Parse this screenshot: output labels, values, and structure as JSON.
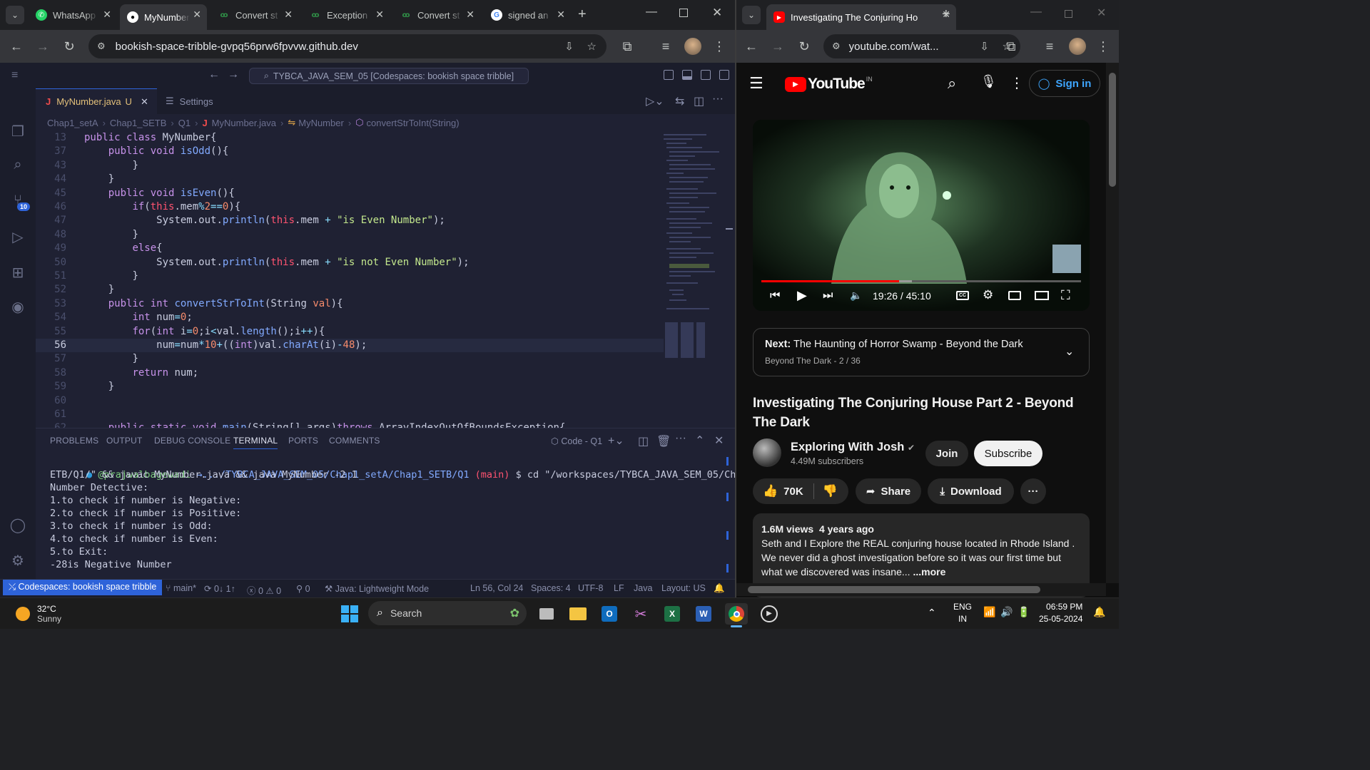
{
  "left_browser": {
    "tabs": [
      {
        "title": "WhatsApp",
        "icon": "whatsapp-icon"
      },
      {
        "title": "MyNumber",
        "icon": "github-icon",
        "active": true
      },
      {
        "title": "Convert st",
        "icon": "geeksforgeeks-icon"
      },
      {
        "title": "Exception",
        "icon": "geeksforgeeks-icon"
      },
      {
        "title": "Convert st",
        "icon": "geeksforgeeks-icon"
      },
      {
        "title": "signed an",
        "icon": "google-icon"
      }
    ],
    "url": "bookish-space-tribble-gvpq56prw6fpvvw.github.dev"
  },
  "vscode": {
    "command_center": "TYBCA_JAVA_SEM_05 [Codespaces: bookish space tribble]",
    "tabs": [
      {
        "label": "MyNumber.java",
        "badge": "U",
        "active": true
      },
      {
        "label": "Settings",
        "active": false
      }
    ],
    "breadcrumb": [
      "Chap1_setA",
      "Chap1_SETB",
      "Q1",
      "MyNumber.java",
      "MyNumber",
      "convertStrToInt(String)"
    ],
    "scm_badge": "10",
    "code_lines": [
      {
        "n": "13",
        "html": "<span class='kw'>public</span> <span class='kw'>class</span> <span class='pl'>MyNumber{</span>"
      },
      {
        "n": "37",
        "html": "    <span class='kw'>public</span> <span class='kw'>void</span> <span class='fn'>isOdd</span><span class='pl'>(){</span>"
      },
      {
        "n": "43",
        "html": "        <span class='pl'>}</span>"
      },
      {
        "n": "44",
        "html": "    <span class='pl'>}</span>"
      },
      {
        "n": "45",
        "html": "    <span class='kw'>public</span> <span class='kw'>void</span> <span class='fn'>isEven</span><span class='pl'>(){</span>"
      },
      {
        "n": "46",
        "html": "        <span class='kw'>if</span><span class='pl'>(</span><span class='th'>this</span><span class='pl'>.mem</span><span class='op'>%</span><span class='num'>2</span><span class='op'>==</span><span class='num'>0</span><span class='pl'>){</span>"
      },
      {
        "n": "47",
        "html": "            <span class='pl'>System.out.</span><span class='fn'>println</span><span class='pl'>(</span><span class='th'>this</span><span class='pl'>.mem </span><span class='op'>+</span> <span class='str'>\"is Even Number\"</span><span class='pl'>);</span>"
      },
      {
        "n": "48",
        "html": "        <span class='pl'>}</span>"
      },
      {
        "n": "49",
        "html": "        <span class='kw'>else</span><span class='pl'>{</span>"
      },
      {
        "n": "50",
        "html": "            <span class='pl'>System.out.</span><span class='fn'>println</span><span class='pl'>(</span><span class='th'>this</span><span class='pl'>.mem </span><span class='op'>+</span> <span class='str'>\"is not Even Number\"</span><span class='pl'>);</span>"
      },
      {
        "n": "51",
        "html": "        <span class='pl'>}</span>"
      },
      {
        "n": "52",
        "html": "    <span class='pl'>}</span>"
      },
      {
        "n": "53",
        "html": "    <span class='kw'>public</span> <span class='kw'>int</span> <span class='fn'>convertStrToInt</span><span class='pl'>(String </span><span class='num'>val</span><span class='pl'>){</span>"
      },
      {
        "n": "54",
        "html": "        <span class='kw'>int</span> <span class='pl'>num</span><span class='op'>=</span><span class='num'>0</span><span class='pl'>;</span>"
      },
      {
        "n": "55",
        "html": "        <span class='kw'>for</span><span class='pl'>(</span><span class='kw'>int</span> <span class='pl'>i</span><span class='op'>=</span><span class='num'>0</span><span class='pl'>;i</span><span class='op'>&lt;</span><span class='pl'>val.</span><span class='fn'>length</span><span class='pl'>();i</span><span class='op'>++</span><span class='pl'>){</span>"
      },
      {
        "n": "56",
        "html": "            <span class='pl'>num</span><span class='op'>=</span><span class='pl'>num</span><span class='op'>*</span><span class='num'>10</span><span class='op'>+</span><span class='pl'>((</span><span class='kw'>int</span><span class='pl'>)val.</span><span class='fn'>charAt</span><span class='pl'>(i)</span><span class='op'>-</span><span class='num'>48</span><span class='pl'>);</span>",
        "current": true
      },
      {
        "n": "57",
        "html": "        <span class='pl'>}</span>"
      },
      {
        "n": "58",
        "html": "        <span class='kw'>return</span> <span class='pl'>num;</span>"
      },
      {
        "n": "59",
        "html": "    <span class='pl'>}</span>"
      },
      {
        "n": "60",
        "html": ""
      },
      {
        "n": "61",
        "html": ""
      },
      {
        "n": "62",
        "html": "    <span class='kw'>public</span> <span class='kw'>static</span> <span class='kw'>void</span> <span class='fn'>main</span><span class='pl'>(String[] args)</span><span class='kw'>throws</span> <span class='pl'>ArrayIndexOutOfBoundsException{</span>"
      }
    ],
    "panel_tabs": [
      "PROBLEMS",
      "OUTPUT",
      "DEBUG CONSOLE",
      "TERMINAL",
      "PORTS",
      "COMMENTS"
    ],
    "terminal_name": "Code - Q1",
    "terminal": {
      "user": "@prajwalbagewadi",
      "path": "→.../TYBCA_JAVA_SEM_05/Chap1_setA/Chap1_SETB/Q1",
      "branch": "(main)",
      "cmd1": "$ cd \"/workspaces/TYBCA_JAVA_SEM_05/Chap1_setA/Chap1_S",
      "lines": [
        "ETB/Q1/\" && javac MyNumber.java && java MyNumber -2 1",
        "Number Detective:",
        "1.to check if number is Negative:",
        "2.to check if number is Positive:",
        "3.to check if number is Odd:",
        "4.to check if number is Even:",
        "5.to Exit:",
        "-28is Negative Number"
      ]
    },
    "status": {
      "remote": "Codespaces: bookish space tribble",
      "branch": "main*",
      "sync": "0↓ 1↑",
      "errors": "0",
      "warnings": "0",
      "ports": "0",
      "java_mode": "Java: Lightweight Mode",
      "position": "Ln 56, Col 24",
      "spaces": "Spaces: 4",
      "encoding": "UTF-8",
      "eol": "LF",
      "language": "Java",
      "layout": "Layout: US"
    }
  },
  "right_browser": {
    "tab_title": "Investigating The Conjuring Ho",
    "url": "youtube.com/wat...",
    "youtube": {
      "logo_text": "YouTube",
      "country": "IN",
      "sign_in": "Sign in",
      "time": "19:26 / 45:10",
      "progress": 0.43,
      "buffered": 0.47,
      "next_label": "Next:",
      "next_title": "The Haunting of Horror Swamp - Beyond the Dark",
      "next_sub": "Beyond The Dark - 2 / 36",
      "video_title": "Investigating The Conjuring House Part 2 - Beyond The Dark",
      "channel": "Exploring With Josh",
      "subscribers": "4.49M subscribers",
      "join": "Join",
      "subscribe": "Subscribe",
      "likes": "70K",
      "share": "Share",
      "download": "Download",
      "views": "1.6M views",
      "age": "4 years ago",
      "desc1": "Seth and I Explore the REAL conjuring house located in Rhode Island .",
      "desc2": "We never did a ghost investigation before so it was our first time but",
      "desc3": "what we discovered was insane...",
      "more": "...more"
    }
  },
  "taskbar": {
    "temp": "32°C",
    "weather": "Sunny",
    "search": "Search",
    "lang1": "ENG",
    "lang2": "IN",
    "time": "06:59 PM",
    "date": "25-05-2024"
  },
  "colors": {
    "vscode_bg": "#1f2133",
    "accent": "#2e63d9",
    "yt_red": "#ff0000"
  }
}
